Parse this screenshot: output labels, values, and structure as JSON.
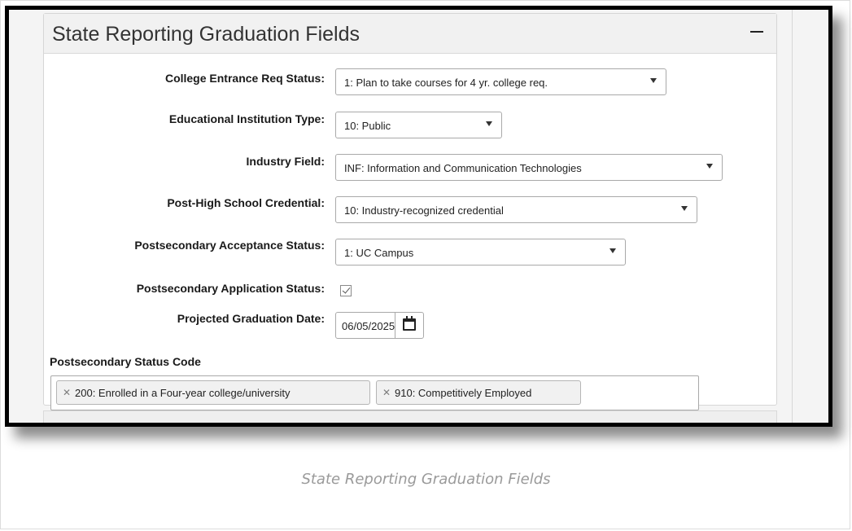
{
  "panel": {
    "title": "State Reporting Graduation Fields"
  },
  "fields": {
    "college_entrance": {
      "label": "College Entrance Req Status:",
      "value": "1: Plan to take courses for 4 yr. college req."
    },
    "institution_type": {
      "label": "Educational Institution Type:",
      "value": "10: Public"
    },
    "industry_field": {
      "label": "Industry Field:",
      "value": "INF: Information and Communication Technologies"
    },
    "credential": {
      "label": "Post-High School Credential:",
      "value": "10: Industry-recognized credential"
    },
    "acceptance_status": {
      "label": "Postsecondary Acceptance Status:",
      "value": "1: UC Campus"
    },
    "application_status": {
      "label": "Postsecondary Application Status:",
      "checked": true
    },
    "graduation_date": {
      "label": "Projected Graduation Date:",
      "value": "06/05/2025"
    }
  },
  "status_code": {
    "label": "Postsecondary Status Code",
    "tags": [
      "200: Enrolled in a Four-year college/university",
      "910: Competitively Employed"
    ],
    "remove_glyph": "✕"
  },
  "caption": "State Reporting Graduation Fields",
  "icons": {
    "collapse": "minus-icon",
    "calendar": "calendar-icon",
    "dropdown": "chevron-down-icon"
  }
}
